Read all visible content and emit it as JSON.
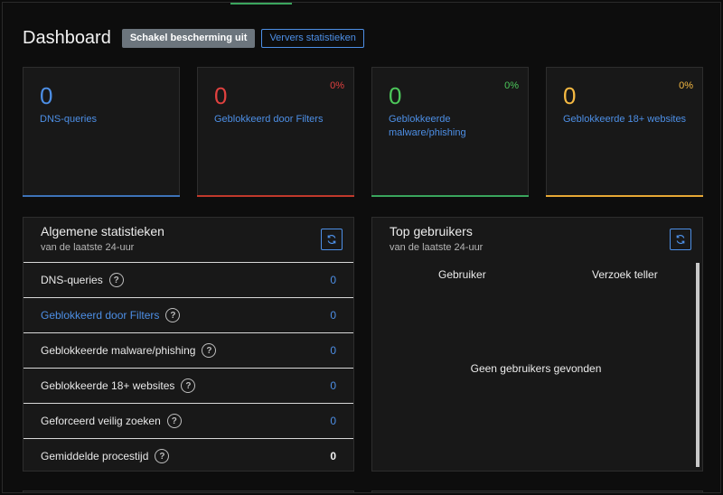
{
  "header": {
    "title": "Dashboard",
    "disable_protection_label": "Schakel bescherming uit",
    "refresh_stats_label": "Ververs statistieken"
  },
  "cards": [
    {
      "value": "0",
      "label": "DNS-queries",
      "percent": "",
      "color": "#4d8fe6",
      "bar_color": "#3d72b8",
      "label_color": "#4d8fe6"
    },
    {
      "value": "0",
      "label": "Geblokkeerd door Filters",
      "percent": "0%",
      "color": "#e0413f",
      "bar_color": "#c0392b",
      "label_color": "#4d8fe6"
    },
    {
      "value": "0",
      "label": "Geblokkeerde malware/phishing",
      "percent": "0%",
      "color": "#4cc75a",
      "bar_color": "#3aa55d",
      "label_color": "#4d8fe6"
    },
    {
      "value": "0",
      "label": "Geblokkeerde 18+ websites",
      "percent": "0%",
      "color": "#f5b942",
      "bar_color": "#e6a835",
      "label_color": "#4d8fe6"
    }
  ],
  "general_stats": {
    "title": "Algemene statistieken",
    "subtitle": "van de laatste 24-uur",
    "rows": [
      {
        "label": "DNS-queries",
        "value": "0",
        "link": false
      },
      {
        "label": "Geblokkeerd door Filters",
        "value": "0",
        "link": true
      },
      {
        "label": "Geblokkeerde malware/phishing",
        "value": "0",
        "link": false
      },
      {
        "label": "Geblokkeerde 18+ websites",
        "value": "0",
        "link": false
      },
      {
        "label": "Geforceerd veilig zoeken",
        "value": "0",
        "link": false
      },
      {
        "label": "Gemiddelde procestijd",
        "value": "0",
        "link": false
      }
    ]
  },
  "top_users": {
    "title": "Top gebruikers",
    "subtitle": "van de laatste 24-uur",
    "col_user": "Gebruiker",
    "col_count": "Verzoek teller",
    "empty_message": "Geen gebruikers gevonden"
  },
  "colors": {
    "accent": "#4d8fe6",
    "background": "#0d0d0d",
    "panel": "#181818"
  },
  "icons": {
    "refresh": "refresh-icon",
    "help": "help-icon"
  }
}
